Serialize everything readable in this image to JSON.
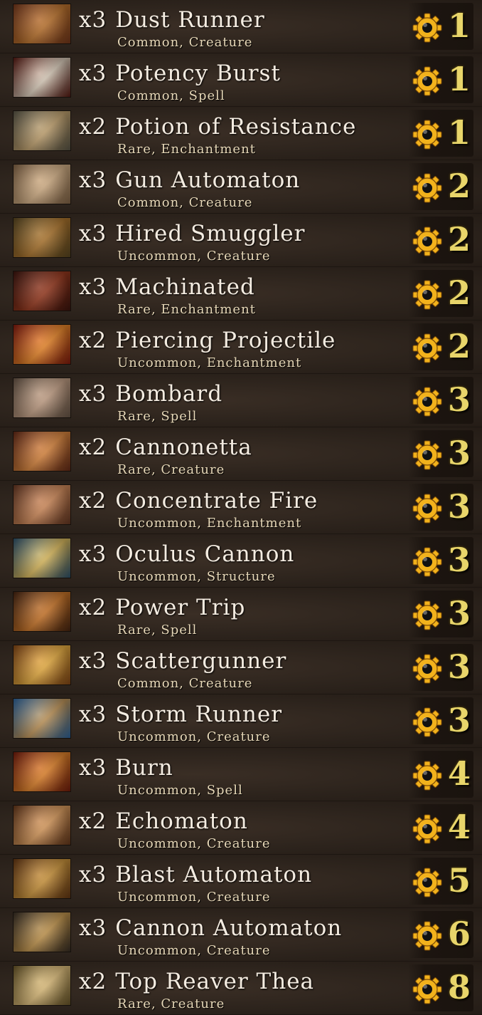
{
  "deck": {
    "cards": [
      {
        "qty": "x3",
        "name": "Dust Runner",
        "info": "Common, Creature",
        "cost": "1",
        "art": [
          "#7a3a1d",
          "#c2772f"
        ]
      },
      {
        "qty": "x3",
        "name": "Potency Burst",
        "info": "Common, Spell",
        "cost": "1",
        "art": [
          "#5a1a12",
          "#e0d2c0"
        ]
      },
      {
        "qty": "x2",
        "name": "Potion of Resistance",
        "info": "Rare, Enchantment",
        "cost": "1",
        "art": [
          "#5e5a4a",
          "#c7a773"
        ]
      },
      {
        "qty": "x3",
        "name": "Gun Automaton",
        "info": "Common, Creature",
        "cost": "2",
        "art": [
          "#8a6a4a",
          "#d9b58a"
        ]
      },
      {
        "qty": "x3",
        "name": "Hired Smuggler",
        "info": "Uncommon, Creature",
        "cost": "2",
        "art": [
          "#5d4a22",
          "#b2792f"
        ]
      },
      {
        "qty": "x3",
        "name": "Machinated",
        "info": "Rare, Enchantment",
        "cost": "2",
        "art": [
          "#3f150e",
          "#9b3a1f"
        ]
      },
      {
        "qty": "x2",
        "name": "Piercing Projectile",
        "info": "Uncommon, Enchantment",
        "cost": "2",
        "art": [
          "#8a1b0e",
          "#f08a2a"
        ]
      },
      {
        "qty": "x3",
        "name": "Bombard",
        "info": "Rare, Spell",
        "cost": "3",
        "art": [
          "#6d5a4a",
          "#c9a58a"
        ]
      },
      {
        "qty": "x2",
        "name": "Cannonetta",
        "info": "Rare, Creature",
        "cost": "3",
        "art": [
          "#6a2c18",
          "#e08a40"
        ]
      },
      {
        "qty": "x2",
        "name": "Concentrate Fire",
        "info": "Uncommon, Enchantment",
        "cost": "3",
        "art": [
          "#6b3a24",
          "#d78f5d"
        ]
      },
      {
        "qty": "x3",
        "name": "Oculus Cannon",
        "info": "Uncommon, Structure",
        "cost": "3",
        "art": [
          "#2f5672",
          "#e2c060"
        ]
      },
      {
        "qty": "x2",
        "name": "Power Trip",
        "info": "Rare, Spell",
        "cost": "3",
        "art": [
          "#4a2612",
          "#d0792a"
        ]
      },
      {
        "qty": "x3",
        "name": "Scattergunner",
        "info": "Common, Creature",
        "cost": "3",
        "art": [
          "#8a4a16",
          "#f0b444"
        ]
      },
      {
        "qty": "x3",
        "name": "Storm Runner",
        "info": "Uncommon, Creature",
        "cost": "3",
        "art": [
          "#2f6aa6",
          "#c69a5c"
        ]
      },
      {
        "qty": "x3",
        "name": "Burn",
        "info": "Uncommon, Spell",
        "cost": "4",
        "art": [
          "#7a1d0c",
          "#e8872c"
        ]
      },
      {
        "qty": "x2",
        "name": "Echomaton",
        "info": "Uncommon, Creature",
        "cost": "4",
        "art": [
          "#6a3a1c",
          "#e0a060"
        ]
      },
      {
        "qty": "x3",
        "name": "Blast Automaton",
        "info": "Uncommon, Creature",
        "cost": "5",
        "art": [
          "#6a3a14",
          "#d39a3e"
        ]
      },
      {
        "qty": "x3",
        "name": "Cannon Automaton",
        "info": "Uncommon, Creature",
        "cost": "6",
        "art": [
          "#3a3026",
          "#c89a50"
        ]
      },
      {
        "qty": "x2",
        "name": "Top Reaver Thea",
        "info": "Rare, Creature",
        "cost": "8",
        "art": [
          "#6e5a2a",
          "#e6c580"
        ]
      }
    ]
  },
  "colors": {
    "gear_fill": "#f2b21c",
    "gear_hole": "#111111",
    "cost_text": "#e8d56a"
  },
  "icons": {
    "cost_icon": "gear-icon"
  }
}
